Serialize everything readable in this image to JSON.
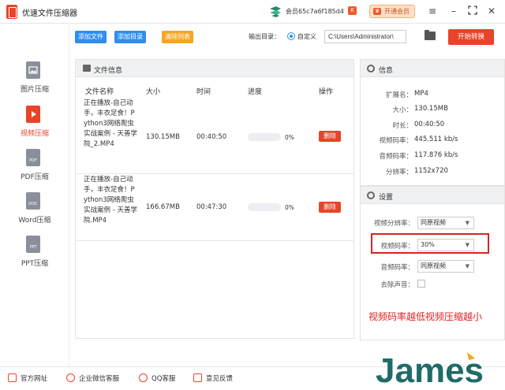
{
  "app": {
    "title": "优速文件压缩器"
  },
  "member": {
    "id": "会员65c7a6f185d4",
    "badge": "K",
    "vip_button": "开通会员"
  },
  "window_controls": [
    "menu-icon",
    "minimize-icon",
    "maximize-icon",
    "close-icon"
  ],
  "sidebar": {
    "items": [
      {
        "label": "图片压缩",
        "icon": "image-file-icon",
        "active": false
      },
      {
        "label": "视频压缩",
        "icon": "video-file-icon",
        "active": true
      },
      {
        "label": "PDF压缩",
        "icon": "pdf-file-icon",
        "icon_text": "PDF",
        "active": false
      },
      {
        "label": "Word压缩",
        "icon": "doc-file-icon",
        "icon_text": "DOC",
        "active": false
      },
      {
        "label": "PPT压缩",
        "icon": "ppt-file-icon",
        "icon_text": "PPT",
        "active": false
      }
    ]
  },
  "toolbar": {
    "add_file": "添加文件",
    "add_dir": "添加目录",
    "clear_list": "清除列表",
    "output_label": "输出目录：",
    "radio_label": "自定义",
    "output_path": "C:\\Users\\Administrator\\",
    "start_button": "开始转换"
  },
  "file_panel": {
    "title": "文件信息",
    "columns": [
      "文件名称",
      "大小",
      "时间",
      "进度",
      "操作"
    ],
    "rows": [
      {
        "name": "正在播放-自己动手，丰衣足食！Python3网络爬虫实战案例 - 天善学院_2.MP4",
        "size": "130.15MB",
        "time": "00:40:50",
        "progress": 0,
        "progress_text": "0%",
        "action": "删除"
      },
      {
        "name": "正在播放-自己动手，丰衣足食！Python3网络爬虫实战案例 - 天善学院.MP4",
        "size": "166.67MB",
        "time": "00:47:30",
        "progress": 0,
        "progress_text": "0%",
        "action": "删除"
      }
    ]
  },
  "info_panel": {
    "title": "信息",
    "rows": [
      {
        "key": "扩展名：",
        "value": "MP4"
      },
      {
        "key": "大小：",
        "value": "130.15MB"
      },
      {
        "key": "时长：",
        "value": "00:40:50"
      },
      {
        "key": "视频码率：",
        "value": "445.511 kb/s"
      },
      {
        "key": "音频码率：",
        "value": "117.876 kb/s"
      },
      {
        "key": "分辨率：",
        "value": "1152x720"
      }
    ]
  },
  "settings_panel": {
    "title": "设置",
    "video_resolution_label": "视频分辨率：",
    "video_resolution_value": "同原视频",
    "video_bitrate_label": "视频码率：",
    "video_bitrate_value": "30%",
    "audio_bitrate_label": "音频码率：",
    "audio_bitrate_value": "同原视频",
    "remove_audio_label": "去除声音："
  },
  "annotation": "视频码率越低视频压缩越小",
  "bottom_bar": {
    "items": [
      {
        "label": "官方网址",
        "icon": "home-icon"
      },
      {
        "label": "企业微信客服",
        "icon": "wechat-icon"
      },
      {
        "label": "QQ客服",
        "icon": "qq-icon"
      },
      {
        "label": "意见反馈",
        "icon": "feedback-icon"
      }
    ]
  },
  "watermark": "James",
  "colors": {
    "accent": "#e8442a",
    "blue": "#2f8ff0",
    "orange": "#f5a623",
    "annotation_red": "#e02020"
  }
}
